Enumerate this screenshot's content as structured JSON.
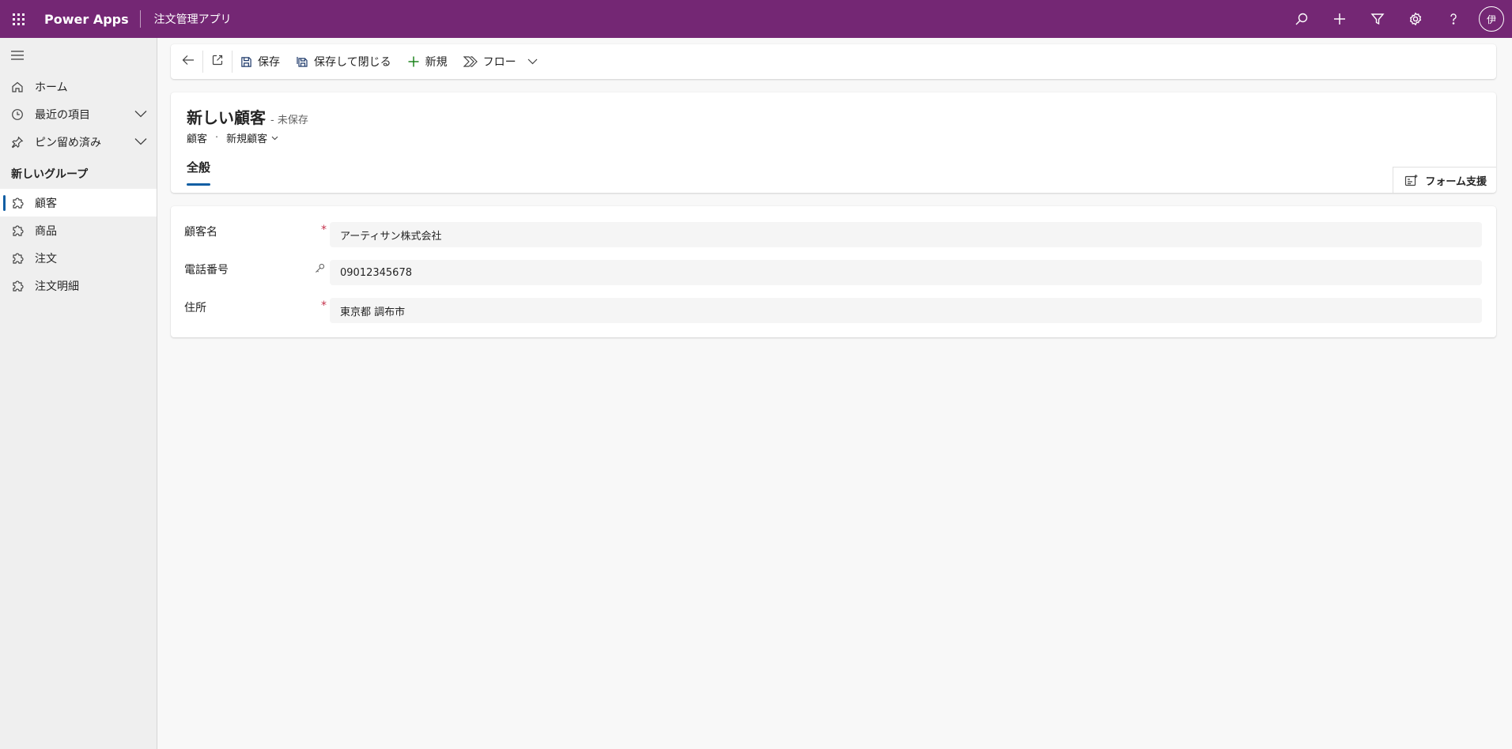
{
  "header": {
    "brand": "Power Apps",
    "app_name": "注文管理アプリ",
    "avatar_initial": "伊",
    "icons": [
      "search-icon",
      "plus-icon",
      "filter-icon",
      "settings-icon",
      "help-icon"
    ]
  },
  "sidebar": {
    "items": [
      {
        "label": "ホーム",
        "icon": "home-icon"
      },
      {
        "label": "最近の項目",
        "icon": "clock-icon"
      },
      {
        "label": "ピン留め済み",
        "icon": "pin-icon"
      }
    ],
    "group_title": "新しいグループ",
    "group_items": [
      {
        "label": "顧客",
        "icon": "puzzle-icon",
        "active": true
      },
      {
        "label": "商品",
        "icon": "puzzle-icon"
      },
      {
        "label": "注文",
        "icon": "puzzle-icon"
      },
      {
        "label": "注文明細",
        "icon": "puzzle-icon"
      }
    ]
  },
  "commandbar": {
    "save": "保存",
    "save_close": "保存して閉じる",
    "new": "新規",
    "flow": "フロー"
  },
  "record": {
    "title": "新しい顧客",
    "status": "- 未保存",
    "entity": "顧客",
    "form": "新規顧客",
    "tab": "全般",
    "form_assist": "フォーム支援"
  },
  "form": {
    "fields": [
      {
        "label": "顧客名",
        "value": "アーティサン株式会社",
        "required": true
      },
      {
        "label": "電話番号",
        "value": "09012345678",
        "locked": true
      },
      {
        "label": "住所",
        "value": "東京都 調布市",
        "required": true
      }
    ]
  },
  "colors": {
    "header_bg": "#742774",
    "accent": "#115ea3",
    "required": "#c4314b"
  }
}
